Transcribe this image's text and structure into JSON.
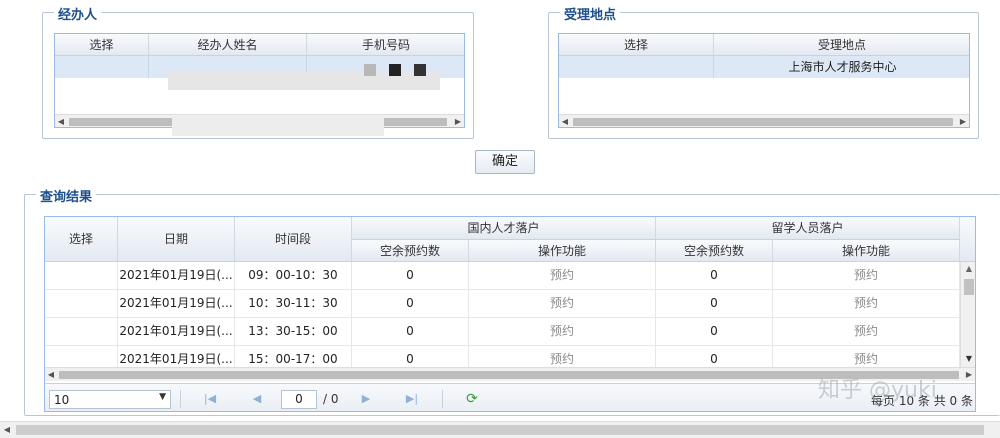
{
  "handler": {
    "legend": "经办人",
    "columns": [
      "选择",
      "经办人姓名",
      "手机号码"
    ],
    "rows": [
      {
        "select": "",
        "name": "",
        "phone": ""
      }
    ]
  },
  "location": {
    "legend": "受理地点",
    "columns": [
      "选择",
      "受理地点"
    ],
    "rows": [
      {
        "select": "",
        "place": "上海市人才服务中心"
      }
    ]
  },
  "confirm_label": "确定",
  "results": {
    "legend": "查询结果",
    "header": {
      "select": "选择",
      "date": "日期",
      "time": "时间段",
      "group1": "国内人才落户",
      "group2": "留学人员落户",
      "slots": "空余预约数",
      "action": "操作功能"
    },
    "rows": [
      {
        "select": "",
        "date": "2021年01月19日(...",
        "time": "09：00-10：30",
        "slots1": "0",
        "action1": "预约",
        "slots2": "0",
        "action2": "预约"
      },
      {
        "select": "",
        "date": "2021年01月19日(...",
        "time": "10：30-11：30",
        "slots1": "0",
        "action1": "预约",
        "slots2": "0",
        "action2": "预约"
      },
      {
        "select": "",
        "date": "2021年01月19日(...",
        "time": "13：30-15：00",
        "slots1": "0",
        "action1": "预约",
        "slots2": "0",
        "action2": "预约"
      },
      {
        "select": "",
        "date": "2021年01月19日(...",
        "time": "15：00-17：00",
        "slots1": "0",
        "action1": "预约",
        "slots2": "0",
        "action2": "预约"
      }
    ]
  },
  "pager": {
    "page_size": "10",
    "page_input": "0",
    "page_total": "/ 0",
    "info": "每页 10 条 共 0 条"
  },
  "watermark": "知乎 @yuki",
  "colors": {
    "legend": "#1d4f8c",
    "header_bg": "#e3e9f1",
    "selected_row": "#dde8f6",
    "border": "#99bbe8"
  },
  "icons": [
    "first-page-icon",
    "prev-page-icon",
    "next-page-icon",
    "last-page-icon",
    "refresh-icon",
    "dropdown-icon"
  ]
}
